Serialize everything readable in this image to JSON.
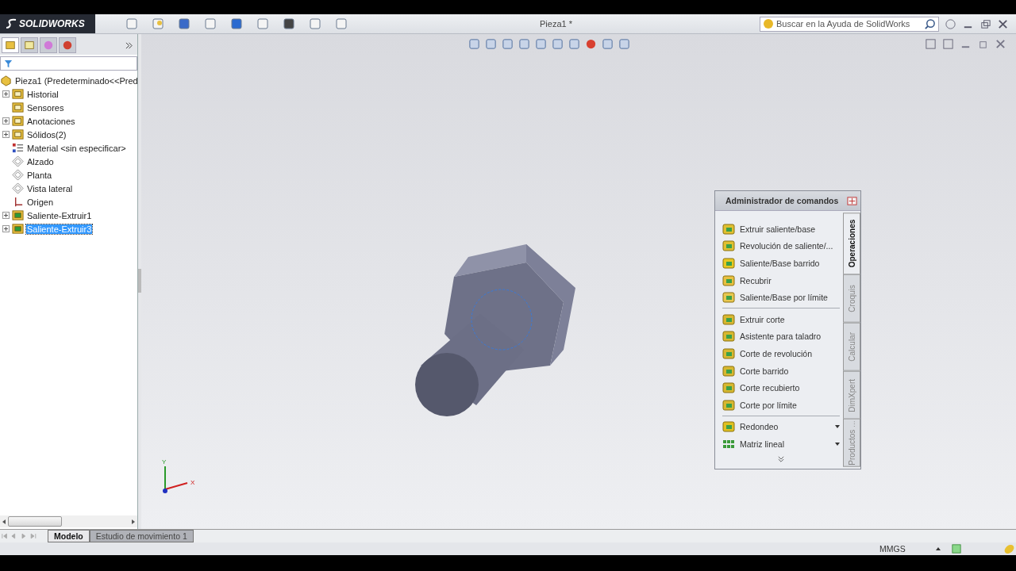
{
  "app": {
    "logo": "SOLIDWORKS",
    "document_title": "Pieza1 *"
  },
  "search": {
    "placeholder": "Buscar en la Ayuda de SolidWorks"
  },
  "panel_tabs": [
    {
      "kind": "tree",
      "selected": true
    },
    {
      "kind": "property",
      "selected": false
    },
    {
      "kind": "config",
      "selected": false
    },
    {
      "kind": "display",
      "selected": false
    }
  ],
  "tree": {
    "root": "Pieza1  (Predeterminado<<Pred",
    "items": [
      {
        "label": "Historial",
        "kind": "history",
        "expandable": true,
        "selected": false
      },
      {
        "label": "Sensores",
        "kind": "sensor",
        "expandable": false,
        "selected": false
      },
      {
        "label": "Anotaciones",
        "kind": "annotation",
        "expandable": true,
        "selected": false
      },
      {
        "label": "Sólidos(2)",
        "kind": "solid",
        "expandable": true,
        "selected": false
      },
      {
        "label": "Material <sin especificar>",
        "kind": "material",
        "expandable": false,
        "selected": false
      },
      {
        "label": "Alzado",
        "kind": "plane",
        "expandable": false,
        "selected": false
      },
      {
        "label": "Planta",
        "kind": "plane",
        "expandable": false,
        "selected": false
      },
      {
        "label": "Vista lateral",
        "kind": "plane",
        "expandable": false,
        "selected": false
      },
      {
        "label": "Origen",
        "kind": "origin",
        "expandable": false,
        "selected": false
      },
      {
        "label": "Saliente-Extruir1",
        "kind": "feature",
        "expandable": true,
        "selected": false
      },
      {
        "label": "Saliente-Extruir3",
        "kind": "feature",
        "expandable": true,
        "selected": true
      }
    ]
  },
  "command_manager": {
    "title": "Administrador de comandos",
    "groups": [
      [
        {
          "label": "Extruir saliente/base",
          "kind": "extrude",
          "has_menu": false
        },
        {
          "label": "Revolución de saliente/...",
          "kind": "revolve",
          "has_menu": false
        },
        {
          "label": "Saliente/Base barrido",
          "kind": "sweep",
          "has_menu": false
        },
        {
          "label": "Recubrir",
          "kind": "loft",
          "has_menu": false
        },
        {
          "label": "Saliente/Base por límite",
          "kind": "boundary",
          "has_menu": false
        }
      ],
      [
        {
          "label": "Extruir corte",
          "kind": "cut",
          "has_menu": false
        },
        {
          "label": "Asistente para taladro",
          "kind": "hole",
          "has_menu": false
        },
        {
          "label": "Corte de revolución",
          "kind": "revcut",
          "has_menu": false
        },
        {
          "label": "Corte barrido",
          "kind": "sweepcut",
          "has_menu": false
        },
        {
          "label": "Corte recubierto",
          "kind": "loftcut",
          "has_menu": false
        },
        {
          "label": "Corte por límite",
          "kind": "boundarycut",
          "has_menu": false
        }
      ],
      [
        {
          "label": "Redondeo",
          "kind": "fillet",
          "has_menu": true
        },
        {
          "label": "Matriz lineal",
          "kind": "pattern",
          "has_menu": true
        }
      ]
    ],
    "tabs": [
      {
        "label": "Operaciones",
        "selected": true
      },
      {
        "label": "Croquis",
        "selected": false
      },
      {
        "label": "Calcular",
        "selected": false
      },
      {
        "label": "DimXpert",
        "selected": false
      },
      {
        "label": "Productos ...",
        "selected": false
      }
    ]
  },
  "triad": {
    "x": "X",
    "y": "Y"
  },
  "model_tabs": [
    {
      "label": "Modelo",
      "selected": true
    },
    {
      "label": "Estudio de movimiento 1",
      "selected": false
    }
  ],
  "status_bar": {
    "units": "MMGS"
  }
}
